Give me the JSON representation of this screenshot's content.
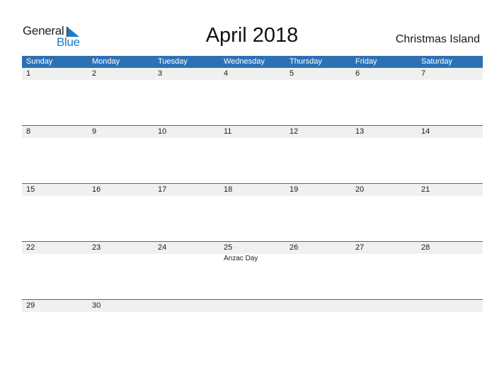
{
  "brand": {
    "word1": "General",
    "word2": "Blue",
    "accent": "#1f7ac7"
  },
  "title": "April 2018",
  "region": "Christmas Island",
  "colors": {
    "header_bg": "#2d71b5",
    "date_row_bg": "#f0f0f0"
  },
  "weekdays": [
    "Sunday",
    "Monday",
    "Tuesday",
    "Wednesday",
    "Thursday",
    "Friday",
    "Saturday"
  ],
  "weeks": [
    {
      "days": [
        "1",
        "2",
        "3",
        "4",
        "5",
        "6",
        "7"
      ],
      "events": [
        "",
        "",
        "",
        "",
        "",
        "",
        ""
      ]
    },
    {
      "days": [
        "8",
        "9",
        "10",
        "11",
        "12",
        "13",
        "14"
      ],
      "events": [
        "",
        "",
        "",
        "",
        "",
        "",
        ""
      ]
    },
    {
      "days": [
        "15",
        "16",
        "17",
        "18",
        "19",
        "20",
        "21"
      ],
      "events": [
        "",
        "",
        "",
        "",
        "",
        "",
        ""
      ]
    },
    {
      "days": [
        "22",
        "23",
        "24",
        "25",
        "26",
        "27",
        "28"
      ],
      "events": [
        "",
        "",
        "",
        "Anzac Day",
        "",
        "",
        ""
      ]
    },
    {
      "days": [
        "29",
        "30",
        "",
        "",
        "",
        "",
        ""
      ],
      "events": [
        "",
        "",
        "",
        "",
        "",
        "",
        ""
      ]
    }
  ]
}
